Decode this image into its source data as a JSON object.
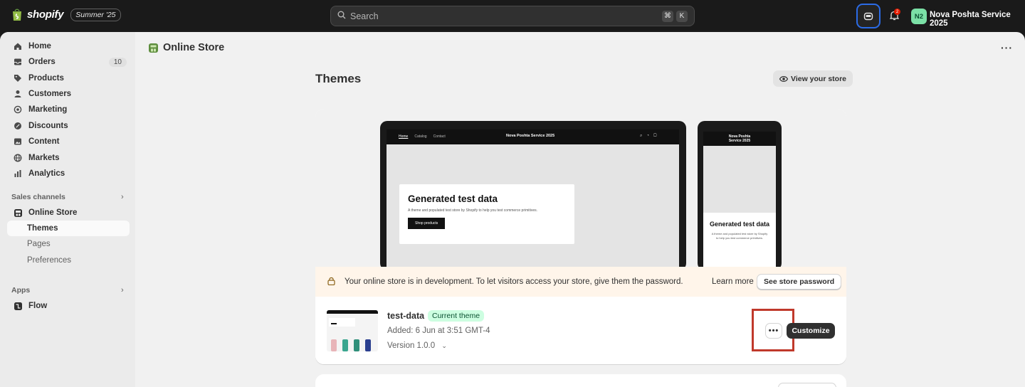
{
  "topbar": {
    "brand_name": "shopify",
    "edition_badge": "Summer '25",
    "search_placeholder": "Search",
    "shortcut_keys": [
      "⌘",
      "K"
    ],
    "notification_count": "2",
    "avatar_initials": "N2",
    "store_name": "Nova Poshta Service 2025"
  },
  "sidebar": {
    "items": [
      {
        "label": "Home",
        "icon": "home-icon"
      },
      {
        "label": "Orders",
        "icon": "orders-icon",
        "count": "10"
      },
      {
        "label": "Products",
        "icon": "tag-icon"
      },
      {
        "label": "Customers",
        "icon": "person-icon"
      },
      {
        "label": "Marketing",
        "icon": "target-icon"
      },
      {
        "label": "Discounts",
        "icon": "discount-icon"
      },
      {
        "label": "Content",
        "icon": "image-icon"
      },
      {
        "label": "Markets",
        "icon": "globe-icon"
      },
      {
        "label": "Analytics",
        "icon": "bar-chart-icon"
      }
    ],
    "sales_channels_label": "Sales channels",
    "online_store_label": "Online Store",
    "sub_items": [
      {
        "label": "Themes",
        "active": true
      },
      {
        "label": "Pages"
      },
      {
        "label": "Preferences"
      }
    ],
    "apps_label": "Apps",
    "apps_items": [
      {
        "label": "Flow",
        "icon": "flow-icon"
      }
    ]
  },
  "page": {
    "header_title": "Online Store",
    "section_title": "Themes",
    "view_store_label": "View your store"
  },
  "preview": {
    "desktop_nav_links": [
      "Home",
      "Catalog",
      "Contact"
    ],
    "store_name": "Nova Poshta Service 2025",
    "hero_heading": "Generated test data",
    "hero_text": "A theme and populated test store by Shopify to help you test commerce primitives.",
    "hero_button": "Shop products",
    "mobile_store_name": "Nova Poshta Service 2025",
    "mobile_heading": "Generated test data",
    "mobile_text": "A theme and populated test store by Shopify to help you test commerce primitives."
  },
  "banner": {
    "message": "Your online store is in development. To let visitors access your store, give them the password.",
    "learn_more": "Learn more",
    "password_button": "See store password"
  },
  "theme": {
    "name": "test-data",
    "badge": "Current theme",
    "added": "Added: 6 Jun at 3:51 GMT-4",
    "version": "Version 1.0.0",
    "more_label": "•••",
    "customize_label": "Customize"
  },
  "colors": {
    "accent_blue": "#2b6be6",
    "highlight_red": "#c0392b",
    "badge_green": "#cdfee1",
    "banner_bg": "#fff5ea"
  }
}
